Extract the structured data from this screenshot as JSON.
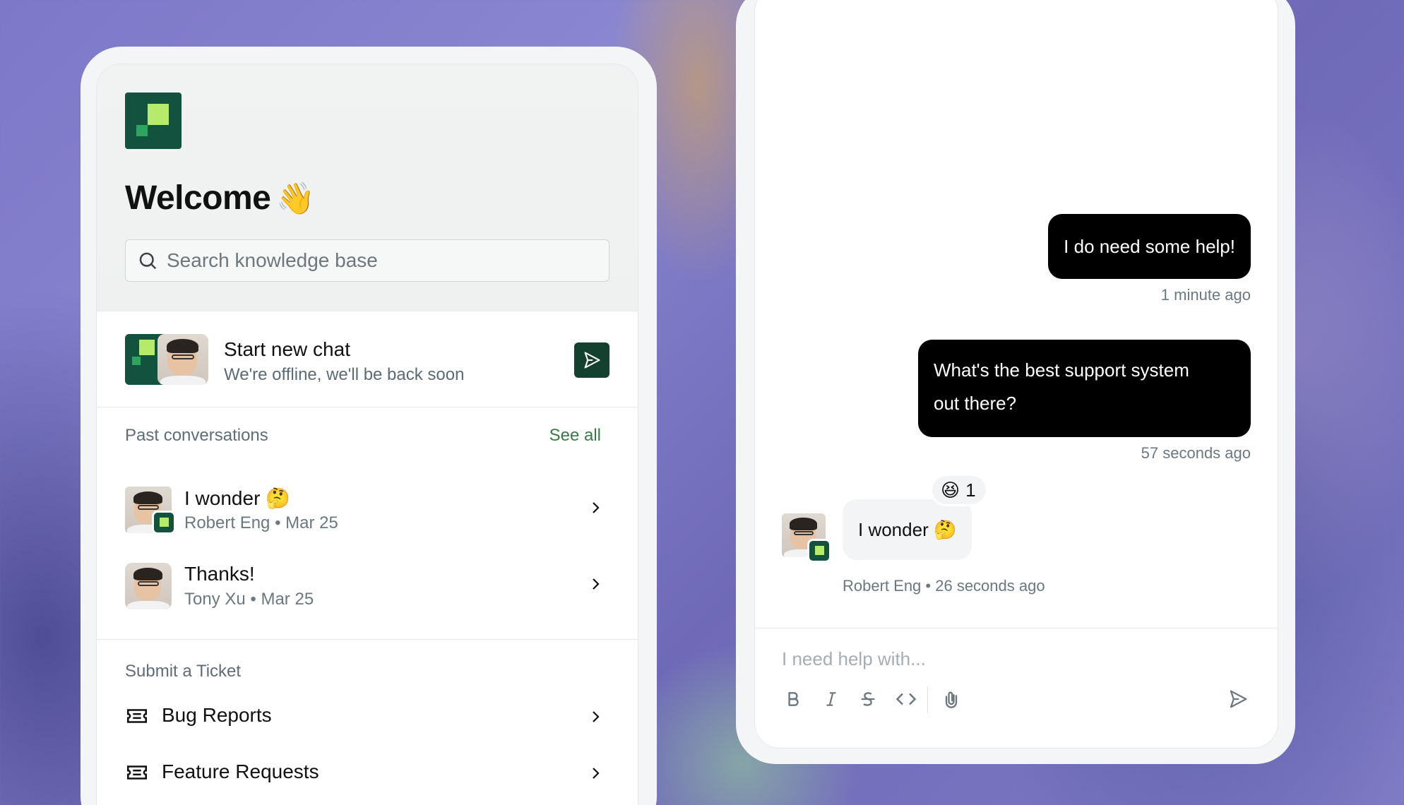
{
  "left_panel": {
    "welcome_title": "Welcome",
    "welcome_emoji": "👋",
    "search": {
      "placeholder": "Search knowledge base"
    },
    "new_chat": {
      "title": "Start new chat",
      "subtitle": "We're offline, we'll be back soon"
    },
    "past_conversations": {
      "label": "Past conversations",
      "see_all": "See all",
      "items": [
        {
          "title": "I wonder",
          "emoji": "🤔",
          "author": "Robert Eng",
          "date": "Mar 25"
        },
        {
          "title": "Thanks!",
          "emoji": "",
          "author": "Tony Xu",
          "date": "Mar 25"
        }
      ]
    },
    "submit_ticket": {
      "label": "Submit a Ticket",
      "items": [
        {
          "label": "Bug Reports"
        },
        {
          "label": "Feature Requests"
        }
      ]
    }
  },
  "chat": {
    "messages": [
      {
        "direction": "out",
        "text": "I do need some help!",
        "time": "1 minute ago"
      },
      {
        "direction": "out",
        "text_line1": "What's the best support system",
        "text_line2": "out there?",
        "time": "57 seconds ago"
      },
      {
        "direction": "in",
        "text": "I wonder",
        "emoji": "🤔",
        "author": "Robert Eng",
        "time": "26 seconds ago",
        "reaction": {
          "emoji": "😆",
          "count": "1"
        }
      }
    ],
    "composer": {
      "placeholder": "I need help with...",
      "tools": [
        "bold-icon",
        "italic-icon",
        "strikethrough-icon",
        "code-icon",
        "attachment-icon",
        "send-icon"
      ]
    }
  },
  "colors": {
    "brand_dark": "#13523f",
    "brand_light": "#b6ea6b",
    "send_button": "#14402f",
    "see_all_link": "#3a7a45"
  }
}
